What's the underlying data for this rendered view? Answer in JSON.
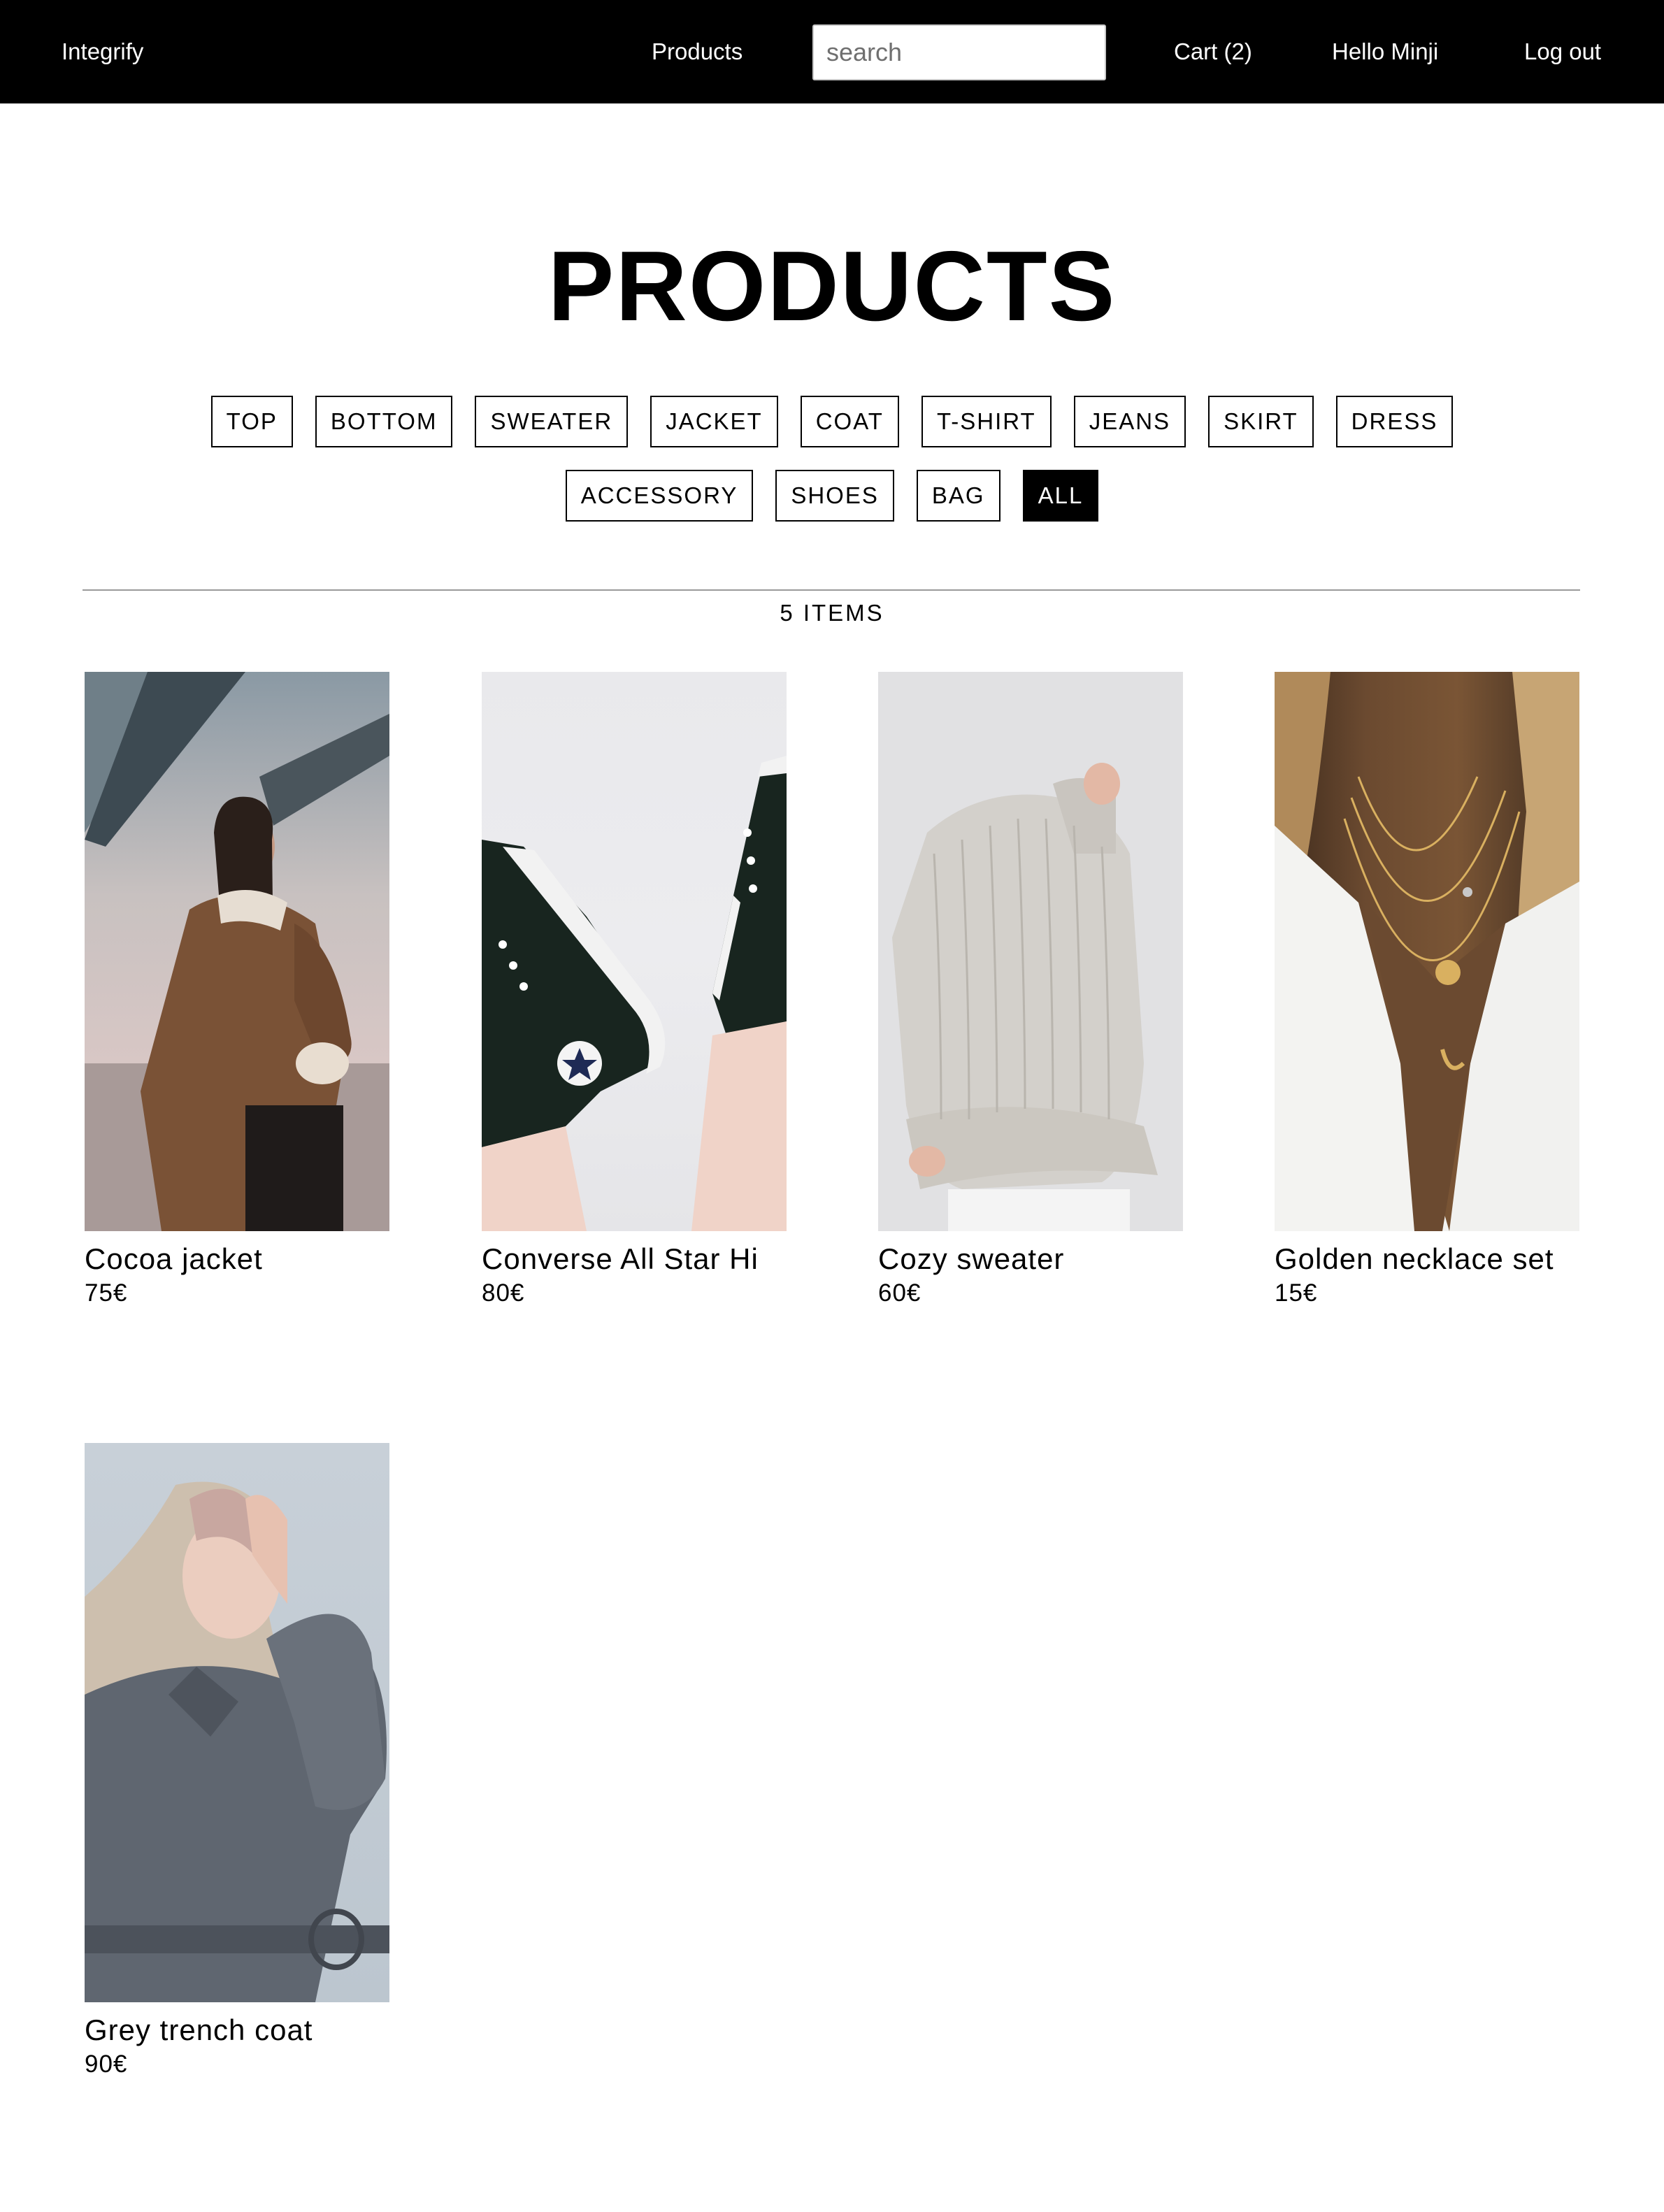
{
  "header": {
    "brand": "Integrify",
    "nav_products": "Products",
    "search_placeholder": "search",
    "cart": "Cart (2)",
    "greeting": "Hello Minji",
    "logout": "Log out"
  },
  "page": {
    "title": "PRODUCTS",
    "item_count": "5 ITEMS"
  },
  "filters": {
    "row1": [
      "TOP",
      "BOTTOM",
      "SWEATER",
      "JACKET",
      "COAT",
      "T-SHIRT",
      "JEANS",
      "SKIRT",
      "DRESS"
    ],
    "row2": [
      "ACCESSORY",
      "SHOES",
      "BAG",
      "ALL"
    ],
    "active": "ALL"
  },
  "products": [
    {
      "name": "Cocoa jacket",
      "price": "75€"
    },
    {
      "name": "Converse All Star Hi",
      "price": "80€"
    },
    {
      "name": "Cozy sweater",
      "price": "60€"
    },
    {
      "name": "Golden necklace set",
      "price": "15€"
    },
    {
      "name": "Grey trench coat",
      "price": "90€"
    }
  ],
  "colors": {
    "header_bg": "#000000",
    "active_chip_bg": "#000000",
    "divider": "#9a9a9a"
  }
}
